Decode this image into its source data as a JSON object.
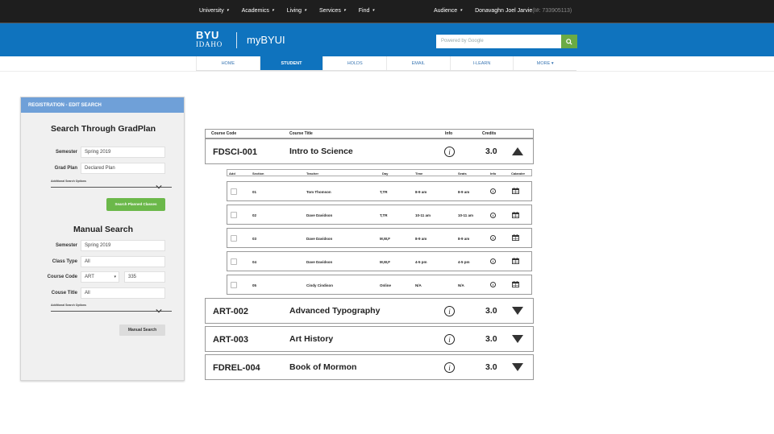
{
  "topnav": {
    "items": [
      "University",
      "Academics",
      "Living",
      "Services",
      "Find"
    ],
    "audience": "Audience",
    "user": "Donavaghn Joel Jarvie",
    "user_id": "(I#: 733905113)"
  },
  "header": {
    "logo_top": "BYU",
    "logo_bottom": "IDAHO",
    "app_name": "myBYUI",
    "search_placeholder": "Powered by Google"
  },
  "tabs": [
    "HOME",
    "STUDENT",
    "HOLDS",
    "EMAIL",
    "I-LEARN",
    "MORE"
  ],
  "active_tab": "STUDENT",
  "sidebar": {
    "header": "REGISTRATION - EDIT SEARCH",
    "gradplan": {
      "title": "Search Through GradPlan",
      "semester_label": "Semester",
      "semester_value": "Spring 2019",
      "gradplan_label": "Grad Plan",
      "gradplan_value": "Declared Plan",
      "advanced": "Additional Search Options",
      "button": "Search Planned Classes"
    },
    "manual": {
      "title": "Manual Search",
      "semester_label": "Semester",
      "semester_value": "Spring 2019",
      "classtype_label": "Class Type",
      "classtype_value": "All",
      "coursecode_label": "Course Code",
      "coursecode_value": "ART",
      "coursenum_value": "335",
      "coursetitle_label": "Couse Title",
      "coursetitle_value": "All",
      "advanced": "Additional Search Options",
      "button": "Manual Search"
    }
  },
  "results": {
    "headers": {
      "code": "Course Code",
      "title": "Course Title",
      "info": "Info",
      "credits": "Credits"
    },
    "courses": [
      {
        "code": "FDSCI-001",
        "title": "Intro to Science",
        "info": "i",
        "credits": "3.0",
        "expanded": true
      },
      {
        "code": "ART-002",
        "title": "Advanced Typography",
        "info": "i",
        "credits": "3.0",
        "expanded": false
      },
      {
        "code": "ART-003",
        "title": "Art History",
        "info": "i",
        "credits": "3.0",
        "expanded": false
      },
      {
        "code": "FDREL-004",
        "title": "Book of Mormon",
        "info": "i",
        "credits": "3.0",
        "expanded": false
      }
    ],
    "section_headers": {
      "add": "Add",
      "section": "Section",
      "teacher": "Teacher",
      "day": "Day",
      "time": "Time",
      "seats": "Seats",
      "info": "Info",
      "calendar": "Calander"
    },
    "sections": [
      {
        "section": "01",
        "teacher": "Tom Thomson",
        "day": "T,TR",
        "time": "8-9 am",
        "seats": "8-9 am"
      },
      {
        "section": "02",
        "teacher": "Dave Davidson",
        "day": "T,TR",
        "time": "10-11 am",
        "seats": "10-11 am"
      },
      {
        "section": "03",
        "teacher": "Dave Davidson",
        "day": "M,W,F",
        "time": "8-9 am",
        "seats": "8-9 am"
      },
      {
        "section": "04",
        "teacher": "Dave Davidson",
        "day": "M,W,F",
        "time": "4-5 pm",
        "seats": "4-5 pm"
      },
      {
        "section": "05",
        "teacher": "Cindy Cindison",
        "day": "Online",
        "time": "N/A",
        "seats": "N/A"
      }
    ]
  }
}
